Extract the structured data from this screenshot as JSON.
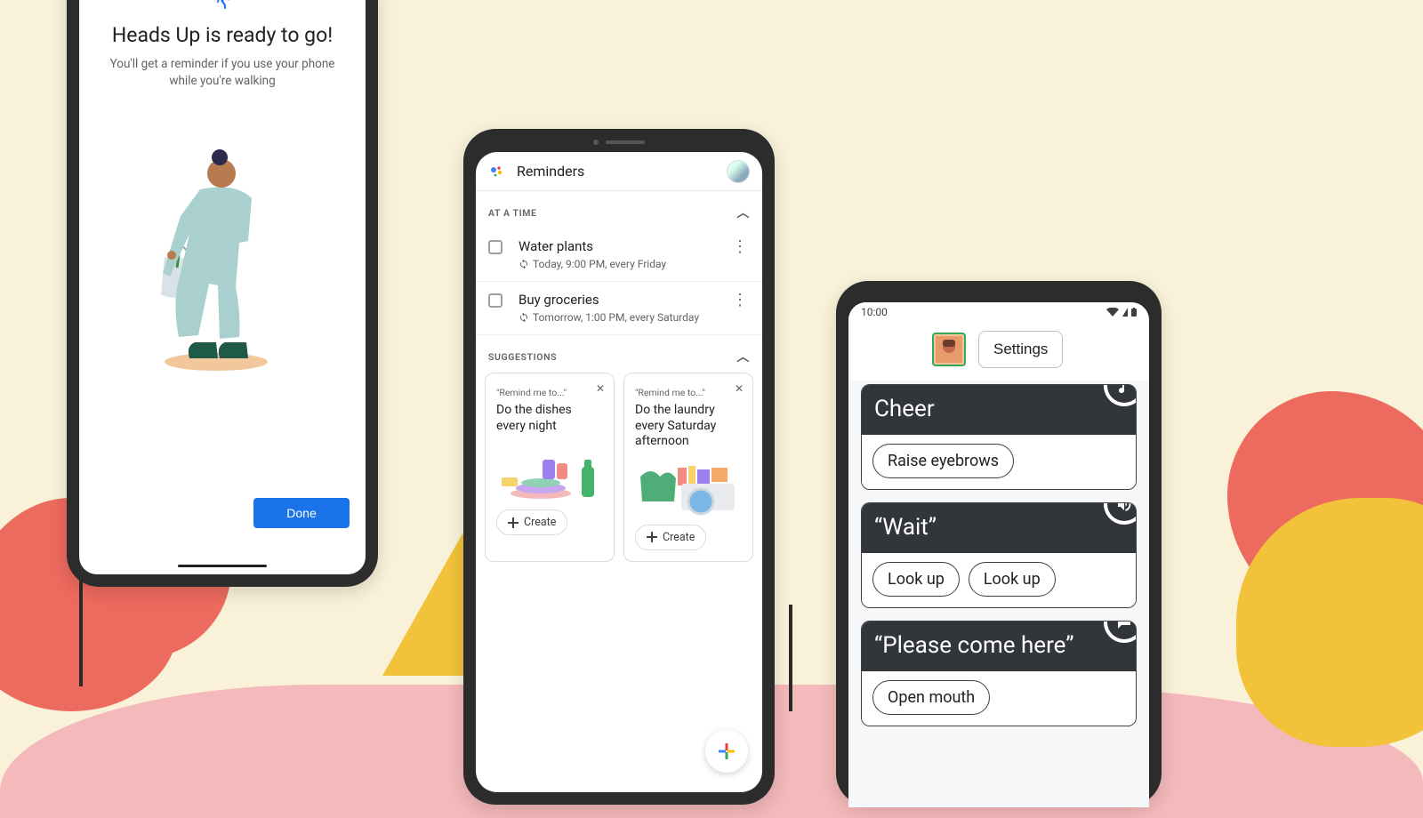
{
  "phone1": {
    "title": "Heads Up is ready to go!",
    "subtitle": "You'll get a reminder if you use your phone while you're walking",
    "done_label": "Done"
  },
  "phone2": {
    "header_title": "Reminders",
    "section_at_a_time": "AT A TIME",
    "section_suggestions": "SUGGESTIONS",
    "items": [
      {
        "name": "Water plants",
        "meta": "Today, 9:00 PM, every Friday"
      },
      {
        "name": "Buy groceries",
        "meta": "Tomorrow, 1:00 PM, every Saturday"
      }
    ],
    "suggestions": [
      {
        "hint": "\"Remind me to...\"",
        "text": "Do the dishes every night",
        "create": "Create"
      },
      {
        "hint": "\"Remind me to...\"",
        "text": "Do the laundry every Saturday afternoon",
        "create": "Create"
      }
    ]
  },
  "phone3": {
    "time": "10:00",
    "settings_label": "Settings",
    "cards": [
      {
        "title": "Cheer",
        "chips": [
          "Raise eyebrows"
        ],
        "icon": "music"
      },
      {
        "title": "“Wait”",
        "chips": [
          "Look up",
          "Look up"
        ],
        "icon": "volume"
      },
      {
        "title": "“Please come here”",
        "chips": [
          "Open mouth"
        ],
        "icon": "chat"
      }
    ]
  }
}
